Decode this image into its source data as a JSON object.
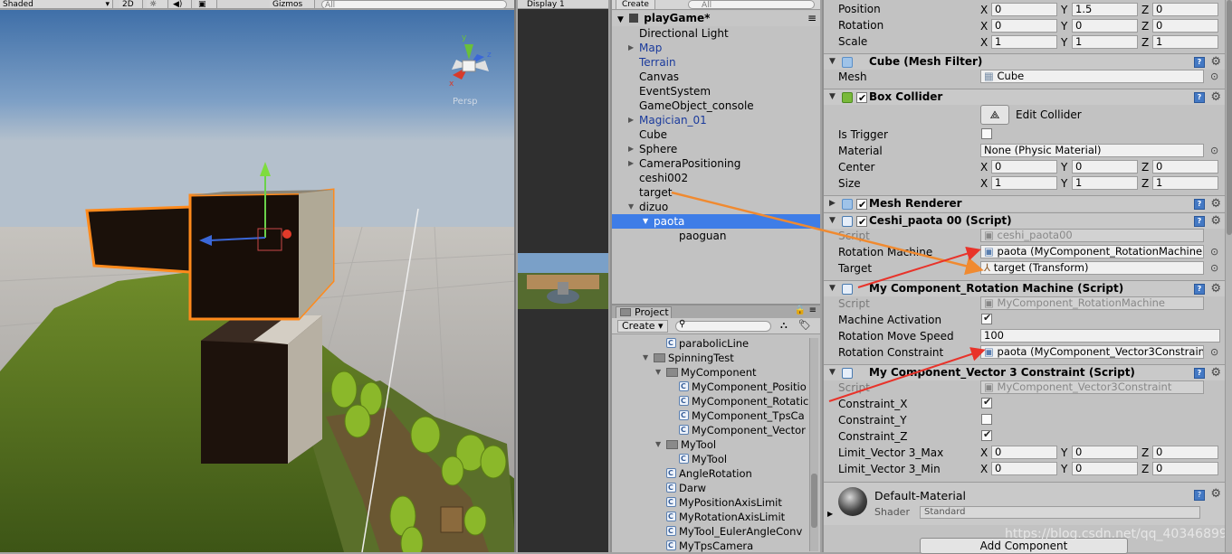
{
  "scene": {
    "toolbar": {
      "shading": "Shaded",
      "mode_2d": "2D",
      "gizmos": "Gizmos",
      "search_placeholder": "All"
    },
    "gizmo_label": "Persp"
  },
  "game": {
    "display": "Display 1"
  },
  "hierarchy": {
    "create": "Create",
    "search_placeholder": "All",
    "scene_name": "playGame*",
    "items": [
      {
        "label": "Directional Light",
        "prefab": false,
        "expand": ""
      },
      {
        "label": "Map",
        "prefab": true,
        "expand": "collapsed"
      },
      {
        "label": "Terrain",
        "prefab": true,
        "expand": ""
      },
      {
        "label": "Canvas",
        "prefab": false,
        "expand": ""
      },
      {
        "label": "EventSystem",
        "prefab": false,
        "expand": ""
      },
      {
        "label": "GameObject_console",
        "prefab": false,
        "expand": ""
      },
      {
        "label": "Magician_01",
        "prefab": true,
        "expand": "collapsed"
      },
      {
        "label": "Cube",
        "prefab": false,
        "expand": ""
      },
      {
        "label": "Sphere",
        "prefab": false,
        "expand": "collapsed"
      },
      {
        "label": "CameraPositioning",
        "prefab": false,
        "expand": "collapsed"
      },
      {
        "label": "ceshi002",
        "prefab": false,
        "expand": ""
      },
      {
        "label": "target",
        "prefab": false,
        "expand": ""
      },
      {
        "label": "dizuo",
        "prefab": false,
        "expand": "expanded"
      },
      {
        "label": "paota",
        "prefab": false,
        "expand": "expanded",
        "selected": true
      },
      {
        "label": "paoguan",
        "prefab": false,
        "expand": ""
      }
    ]
  },
  "project": {
    "tab": "Project",
    "create": "Create",
    "items": [
      {
        "label": "parabolicLine",
        "kind": "script"
      },
      {
        "label": "SpinningTest",
        "kind": "folder"
      },
      {
        "label": "MyComponent",
        "kind": "folder"
      },
      {
        "label": "MyComponent_Positio",
        "kind": "script"
      },
      {
        "label": "MyComponent_Rotatic",
        "kind": "script"
      },
      {
        "label": "MyComponent_TpsCa",
        "kind": "script"
      },
      {
        "label": "MyComponent_Vector",
        "kind": "script"
      },
      {
        "label": "MyTool",
        "kind": "folder"
      },
      {
        "label": "MyTool",
        "kind": "script"
      },
      {
        "label": "AngleRotation",
        "kind": "script"
      },
      {
        "label": "Darw",
        "kind": "script"
      },
      {
        "label": "MyPositionAxisLimit",
        "kind": "script"
      },
      {
        "label": "MyRotationAxisLimit",
        "kind": "script"
      },
      {
        "label": "MyTool_EulerAngleConv",
        "kind": "script"
      },
      {
        "label": "MyTpsCamera",
        "kind": "script"
      }
    ]
  },
  "inspector": {
    "transform": {
      "position_label": "Position",
      "rotation_label": "Rotation",
      "scale_label": "Scale",
      "position": [
        "0",
        "1.5",
        "0"
      ],
      "rotation": [
        "0",
        "0",
        "0"
      ],
      "scale": [
        "1",
        "1",
        "1"
      ]
    },
    "mesh_filter": {
      "title": "Cube (Mesh Filter)",
      "mesh_label": "Mesh",
      "mesh_value": "Cube"
    },
    "box_collider": {
      "title": "Box Collider",
      "edit_label": "Edit Collider",
      "is_trigger_label": "Is Trigger",
      "material_label": "Material",
      "material_value": "None (Physic Material)",
      "center_label": "Center",
      "center": [
        "0",
        "0",
        "0"
      ],
      "size_label": "Size",
      "size": [
        "1",
        "1",
        "1"
      ]
    },
    "mesh_renderer": {
      "title": "Mesh Renderer"
    },
    "ceshi": {
      "title": "Ceshi_paota 00 (Script)",
      "script_label": "Script",
      "script_value": "ceshi_paota00",
      "rotation_machine_label": "Rotation Machine",
      "rotation_machine_value": "paota (MyComponent_RotationMachine)",
      "target_label": "Target",
      "target_value": "target (Transform)"
    },
    "rotation_machine": {
      "title": "My Component_Rotation Machine (Script)",
      "script_label": "Script",
      "script_value": "MyComponent_RotationMachine",
      "activation_label": "Machine Activation",
      "speed_label": "Rotation Move Speed",
      "speed_value": "100",
      "constraint_label": "Rotation Constraint",
      "constraint_value": "paota (MyComponent_Vector3Constrain"
    },
    "vector3": {
      "title": "My Component_Vector 3 Constraint (Script)",
      "script_label": "Script",
      "script_value": "MyComponent_Vector3Constraint",
      "cx_label": "Constraint_X",
      "cy_label": "Constraint_Y",
      "cz_label": "Constraint_Z",
      "max_label": "Limit_Vector 3_Max",
      "max": [
        "0",
        "0",
        "0"
      ],
      "min_label": "Limit_Vector 3_Min",
      "min": [
        "0",
        "0",
        "0"
      ]
    },
    "material": {
      "name": "Default-Material",
      "shader_label": "Shader",
      "shader_value": "Standard"
    },
    "add_component": "Add Component",
    "axes": {
      "x": "X",
      "y": "Y",
      "z": "Z"
    },
    "watermark": "https://blog.csdn.net/qq_40346899"
  },
  "colors": {
    "selection": "#3e7de7",
    "annotation_orange": "#f08a30",
    "annotation_red": "#e8332a",
    "prefab_blue": "#1a3a9c"
  }
}
